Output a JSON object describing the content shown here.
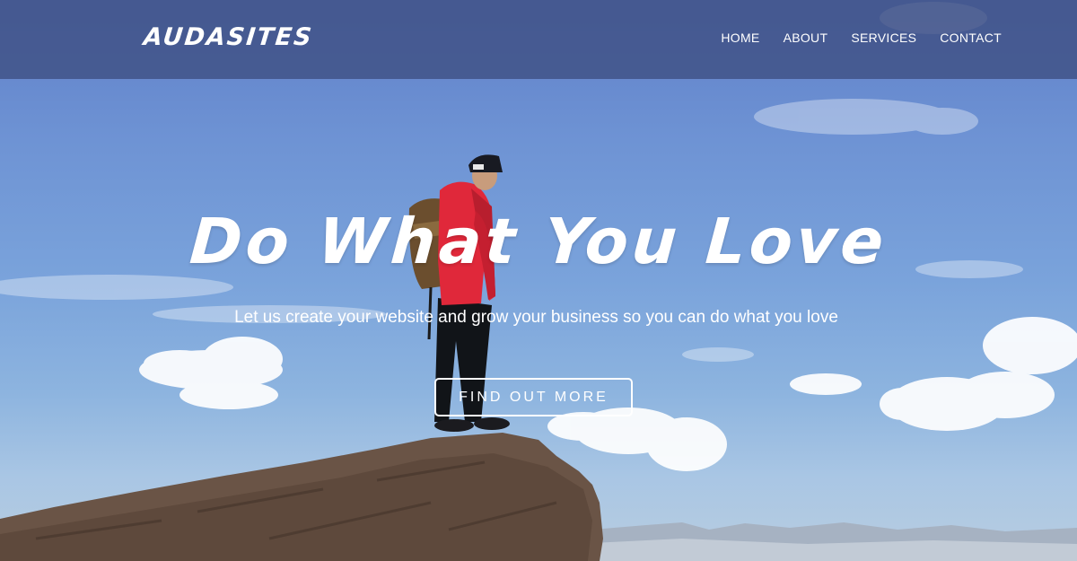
{
  "header": {
    "brand": "AUDASITES",
    "nav": [
      "HOME",
      "ABOUT",
      "SERVICES",
      "CONTACT"
    ]
  },
  "hero": {
    "headline": "Do What You Love",
    "subheadline": "Let us create your website and grow your business so you can do what you love",
    "cta_label": "FIND OUT MORE"
  },
  "colors": {
    "sky": "#7aa3db",
    "navbar": "#3e4e82",
    "text": "#ffffff",
    "jacket": "#e0283a"
  }
}
